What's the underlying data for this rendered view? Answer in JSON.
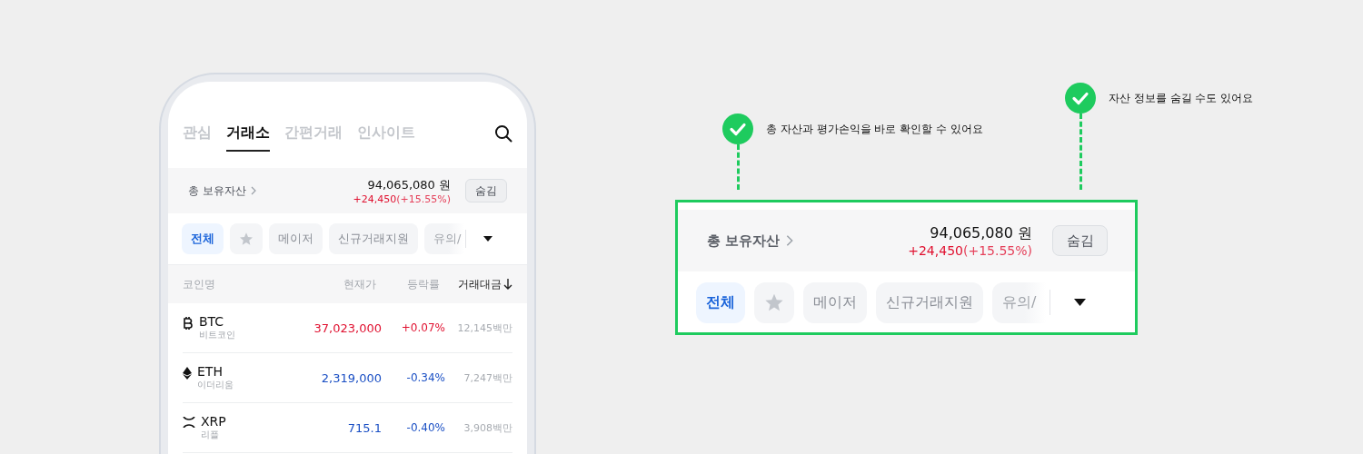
{
  "phone": {
    "tabs": [
      {
        "label": "관심",
        "selected": false
      },
      {
        "label": "거래소",
        "selected": true
      },
      {
        "label": "간편거래",
        "selected": false
      },
      {
        "label": "인사이트",
        "selected": false
      }
    ],
    "summary": {
      "label": "총 보유자산",
      "total": "94,065,080 원",
      "change": "+24,450",
      "change_rate": "(+15.55%)",
      "hide_button": "숨김"
    },
    "filters": [
      {
        "kind": "text",
        "label": "전체",
        "selected": true
      },
      {
        "kind": "star",
        "selected": false
      },
      {
        "kind": "text",
        "label": "메이저",
        "selected": false
      },
      {
        "kind": "text",
        "label": "신규거래지원",
        "selected": false
      },
      {
        "kind": "faded",
        "label": "유의/",
        "selected": false
      }
    ],
    "columns": [
      "코인명",
      "현재가",
      "등락률",
      "거래대금"
    ],
    "rows": [
      {
        "kind": "btc",
        "symbol": "BTC",
        "name": "비트코인",
        "price": "37,023,000",
        "change": "+0.07%",
        "volume": "12,145백만",
        "color": "#e0102f"
      },
      {
        "kind": "eth",
        "symbol": "ETH",
        "name": "이더리움",
        "price": "2,319,000",
        "change": "-0.34%",
        "volume": "7,247백만",
        "color": "#1a4fc4"
      },
      {
        "kind": "xrp",
        "symbol": "XRP",
        "name": "리플",
        "price": "715.1",
        "change": "-0.40%",
        "volume": "3,908백만",
        "color": "#1a4fc4"
      }
    ]
  },
  "callouts": [
    {
      "text": "총 자산과 평가손익을 바로 확인할 수 있어요"
    },
    {
      "text": "자산 정보를 숨길 수도 있어요"
    }
  ],
  "zoom": {
    "summary": {
      "label": "총 보유자산",
      "total": "94,065,080 원",
      "change": "+24,450",
      "change_rate": "(+15.55%)",
      "hide_button": "숨김"
    },
    "filters": [
      {
        "kind": "text",
        "label": "전체",
        "selected": true
      },
      {
        "kind": "star",
        "selected": false
      },
      {
        "kind": "text",
        "label": "메이저",
        "selected": false
      },
      {
        "kind": "text",
        "label": "신규거래지원",
        "selected": false
      },
      {
        "kind": "faded",
        "label": "유의/",
        "selected": false
      }
    ]
  }
}
